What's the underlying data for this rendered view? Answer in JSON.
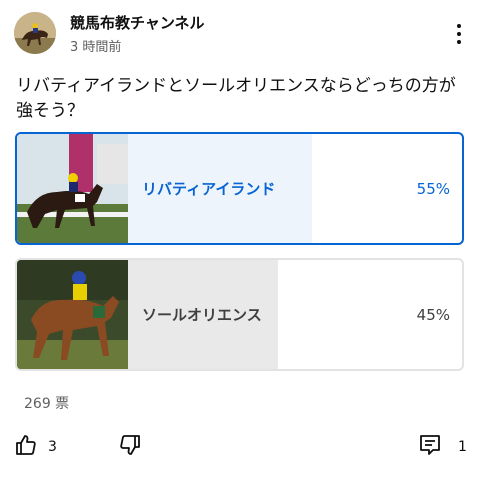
{
  "header": {
    "channel_name": "競馬布教チャンネル",
    "post_time": "3 時間前",
    "avatar_icon": "horse-race-photo",
    "menu_icon": "more-vertical-icon"
  },
  "poll": {
    "question": "リバティアイランドとソールオリエンスならどっちの方が強そう？",
    "options": [
      {
        "label": "リバティアイランド",
        "percent": "55%",
        "fraction": 0.55,
        "selected": true,
        "image": "horse-race-photo"
      },
      {
        "label": "ソールオリエンス",
        "percent": "45%",
        "fraction": 0.45,
        "selected": false,
        "image": "horse-race-photo"
      }
    ],
    "vote_count": "269 票"
  },
  "actions": {
    "like_icon": "thumbs-up-icon",
    "like_count": "3",
    "dislike_icon": "thumbs-down-icon",
    "comment_icon": "comment-icon",
    "comment_count": "1"
  },
  "colors": {
    "accent": "#0664d3",
    "selected_fill": "#eef4fc",
    "unselected_fill": "#e9e9e9"
  }
}
